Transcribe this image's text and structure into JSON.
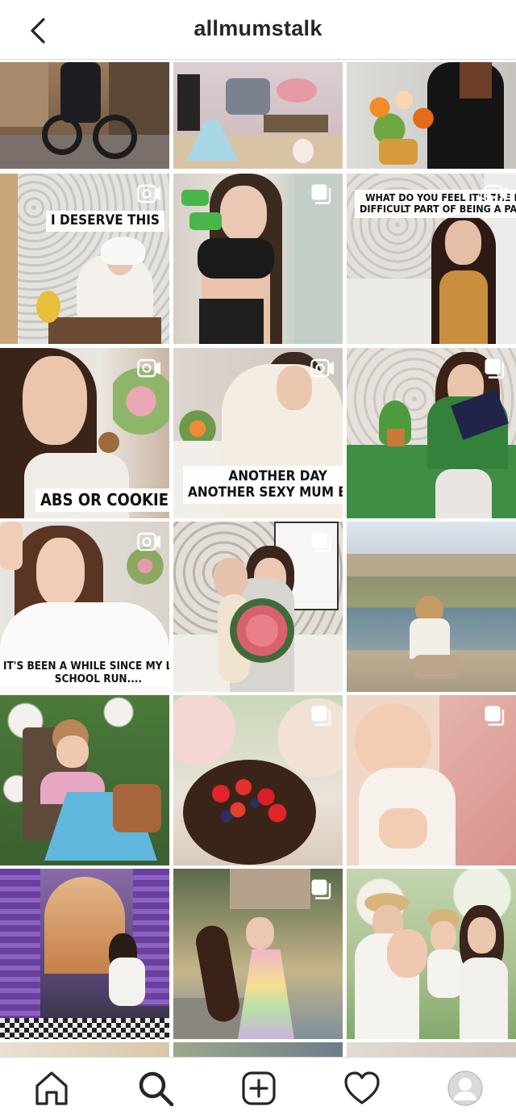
{
  "header": {
    "title": "allmumstalk"
  },
  "captions": {
    "r2c1": "I DESERVE THIS",
    "r2c3_line1": "WHAT DO YOU FEEL IT'S THE MOST",
    "r2c3_line2": "DIFFICULT PART OF BEING A PARENT?",
    "r3c1": "ABS OR COOKIES?",
    "r3c2_line1": "ANOTHER DAY",
    "r3c2_line2": "ANOTHER SEXY MUM BUN",
    "r4c1_line1": "IT'S BEEN A WHILE SINCE MY LAST",
    "r4c1_line2": "SCHOOL RUN...."
  },
  "badges": {
    "video": "video-icon",
    "carousel": "carousel-icon"
  },
  "nav": {
    "home": "home-icon",
    "search": "search-icon",
    "add": "add-post-icon",
    "activity": "heart-icon",
    "profile": "avatar"
  },
  "colors": {
    "text": "#262626",
    "border": "#dbdbdb"
  }
}
